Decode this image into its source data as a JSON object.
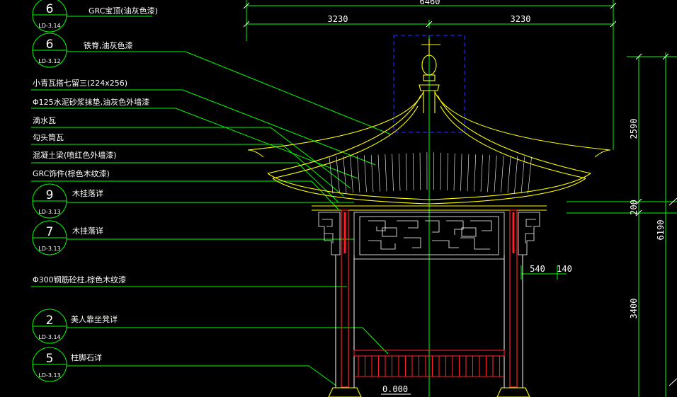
{
  "drawing": {
    "colors": {
      "leader": "#00ff00",
      "outline": "#ffff00",
      "column": "#ff2020",
      "hidden": "#2020ff",
      "dimension": "#ffffff",
      "text": "#ffffff"
    }
  },
  "callouts": [
    {
      "tag_num": "6",
      "tag_ref": "LD-3.14",
      "label": "GRC宝顶(油灰色漆)"
    },
    {
      "tag_num": "6",
      "tag_ref": "LD-3.12",
      "label": "铁脊,油灰色漆"
    },
    {
      "label": "小青瓦搭七留三(224x256)"
    },
    {
      "label": "Φ125水泥砂浆抹垫,油灰色外墙漆"
    },
    {
      "label": "滴水瓦"
    },
    {
      "label": "勾头筒瓦"
    },
    {
      "label": "混凝土梁(喷红色外墙漆)"
    },
    {
      "label": "GRC饰件(棕色木纹漆)"
    },
    {
      "tag_num": "9",
      "tag_ref": "LD-3.13",
      "label": "木挂落详"
    },
    {
      "tag_num": "7",
      "tag_ref": "LD-3.13",
      "label": "木挂落详"
    },
    {
      "label": "Φ300钢筋砼柱,棕色木纹漆"
    },
    {
      "tag_num": "2",
      "tag_ref": "LD-3.14",
      "label": "美人靠坐凳详"
    },
    {
      "tag_num": "5",
      "tag_ref": "LD-3.13",
      "label": "柱脚石详"
    }
  ],
  "dimensions": {
    "overall_width": "6460",
    "half_left": "3230",
    "half_right": "3230",
    "height_top": "2590",
    "height_beam": "200",
    "height_total": "6190",
    "height_column": "3400",
    "offset_a": "540",
    "offset_b": "140",
    "elevation": "0.000"
  }
}
